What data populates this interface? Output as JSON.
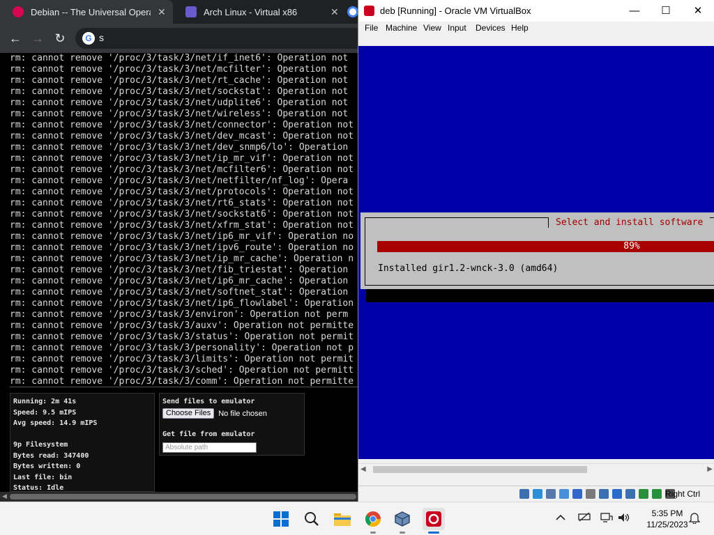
{
  "chrome": {
    "tabs": [
      {
        "title": "Debian -- The Universal Operating System",
        "favicon_color": "#d70751",
        "close": "✕"
      },
      {
        "title": "Arch Linux - Virtual x86",
        "favicon_color": "#6a5acd",
        "close": "✕"
      },
      {
        "title": "",
        "favicon_color": "#4285f4"
      }
    ],
    "nav": {
      "back": "←",
      "forward": "→",
      "reload": "↻"
    },
    "omnibox": {
      "engine_glyph": "G",
      "query": "s"
    }
  },
  "terminal": {
    "lines": [
      "rm: cannot remove '/proc/3/task/3/net/if_inet6': Operation not",
      "rm: cannot remove '/proc/3/task/3/net/mcfilter': Operation not",
      "rm: cannot remove '/proc/3/task/3/net/rt_cache': Operation not",
      "rm: cannot remove '/proc/3/task/3/net/sockstat': Operation not",
      "rm: cannot remove '/proc/3/task/3/net/udplite6': Operation not",
      "rm: cannot remove '/proc/3/task/3/net/wireless': Operation not",
      "rm: cannot remove '/proc/3/task/3/net/connector': Operation not",
      "rm: cannot remove '/proc/3/task/3/net/dev_mcast': Operation not",
      "rm: cannot remove '/proc/3/task/3/net/dev_snmp6/lo': Operation",
      "rm: cannot remove '/proc/3/task/3/net/ip_mr_vif': Operation not",
      "rm: cannot remove '/proc/3/task/3/net/mcfilter6': Operation not",
      "rm: cannot remove '/proc/3/task/3/net/netfilter/nf_log': Opera",
      "rm: cannot remove '/proc/3/task/3/net/protocols': Operation not",
      "rm: cannot remove '/proc/3/task/3/net/rt6_stats': Operation not",
      "rm: cannot remove '/proc/3/task/3/net/sockstat6': Operation not",
      "rm: cannot remove '/proc/3/task/3/net/xfrm_stat': Operation not",
      "rm: cannot remove '/proc/3/task/3/net/ip6_mr_vif': Operation no",
      "rm: cannot remove '/proc/3/task/3/net/ipv6_route': Operation no",
      "rm: cannot remove '/proc/3/task/3/net/ip_mr_cache': Operation n",
      "rm: cannot remove '/proc/3/task/3/net/fib_triestat': Operation",
      "rm: cannot remove '/proc/3/task/3/net/ip6_mr_cache': Operation",
      "rm: cannot remove '/proc/3/task/3/net/softnet_stat': Operation",
      "rm: cannot remove '/proc/3/task/3/net/ip6_flowlabel': Operation",
      "rm: cannot remove '/proc/3/task/3/environ': Operation not perm",
      "rm: cannot remove '/proc/3/task/3/auxv': Operation not permitte",
      "rm: cannot remove '/proc/3/task/3/status': Operation not permit",
      "rm: cannot remove '/proc/3/task/3/personality': Operation not p",
      "rm: cannot remove '/proc/3/task/3/limits': Operation not permit",
      "rm: cannot remove '/proc/3/task/3/sched': Operation not permitt",
      "rm: cannot remove '/proc/3/task/3/comm': Operation not permitte"
    ]
  },
  "emulator": {
    "stats": [
      "Running: 2m 41s",
      "Speed: 9.5 mIPS",
      "Avg speed: 14.9 mIPS",
      "",
      "9p Filesystem",
      "Bytes read: 347400",
      "Bytes written: 0",
      "Last file: bin",
      "Status: Idle"
    ],
    "send_label": "Send files to emulator",
    "choose_button": "Choose Files",
    "no_file": "No file chosen",
    "get_label": "Get file from emulator",
    "path_placeholder": "Absolute path"
  },
  "vbox": {
    "title": "deb [Running] - Oracle VM VirtualBox",
    "window_buttons": {
      "minimize": "—",
      "maximize": "☐",
      "close": "✕"
    },
    "menu": [
      "File",
      "Machine",
      "View",
      "Input",
      "Devices",
      "Help"
    ],
    "installer": {
      "dialog_title": "Select and install software",
      "progress_percent": 89,
      "progress_text": "89%",
      "message": "Installed gir1.2-wnck-3.0 (amd64)"
    },
    "host_key": "Right Ctrl",
    "status_icon_colors": [
      "#3a6fb0",
      "#2a8fd8",
      "#5577aa",
      "#4a90d9",
      "#3366cc",
      "#7a7a7a",
      "#3a6fb0",
      "#2a6acc",
      "#3a6fb0",
      "#2a8f3a",
      "#2a8f3a",
      "#555555"
    ]
  },
  "taskbar": {
    "apps": [
      "start-icon",
      "search-icon",
      "file-explorer-icon",
      "chrome-icon",
      "virtualbox-icon",
      "debian-icon"
    ],
    "tray": {
      "chevron": "^",
      "network": "▭",
      "volume": "🔊",
      "notifications": "🔔"
    },
    "time": "5:35 PM",
    "date": "11/25/2023"
  }
}
